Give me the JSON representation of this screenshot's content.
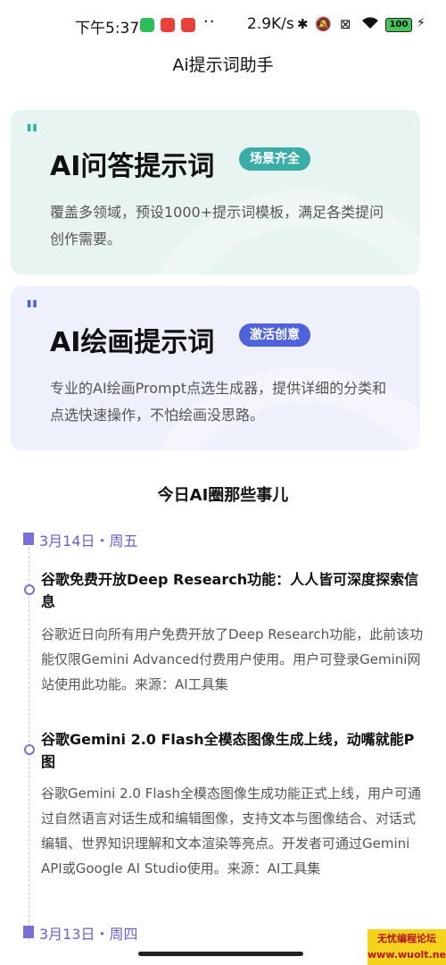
{
  "status_bar": {
    "time": "下午5:37",
    "dots": "··",
    "net_speed": "2.9K/s",
    "battery": "100"
  },
  "page_title": "Ai提示词助手",
  "cards": [
    {
      "title": "AI问答提示词",
      "badge": "场景齐全",
      "desc": "覆盖多领域，预设1000+提示词模板，满足各类提问创作需要。"
    },
    {
      "title": "AI绘画提示词",
      "badge": "激活创意",
      "desc": "专业的AI绘画Prompt点选生成器，提供详细的分类和点选快速操作，不怕绘画没思路。"
    }
  ],
  "section_title": "今日AI圈那些事儿",
  "dates": [
    "3月14日・周五",
    "3月13日・周四"
  ],
  "news": [
    {
      "title": "谷歌免费开放Deep Research功能：人人皆可深度探索信息",
      "body": "谷歌近日向所有用户免费开放了Deep Research功能，此前该功能仅限Gemini Advanced付费用户使用。用户可登录Gemini网站使用此功能。来源：AI工具集"
    },
    {
      "title": "谷歌Gemini 2.0 Flash全模态图像生成上线，动嘴就能P图",
      "body": "谷歌Gemini 2.0 Flash全模态图像生成功能正式上线，用户可通过自然语言对话生成和编辑图像，支持文本与图像结合、对话式编辑、世界知识理解和文本渲染等亮点。开发者可通过Gemini API或Google AI Studio使用。来源：AI工具集"
    }
  ],
  "watermark": "无忧编程论坛 www.wuolt.net",
  "colors": {
    "qa_accent": "#3aada7",
    "art_accent": "#4e63db",
    "timeline": "#7a6fd8"
  }
}
